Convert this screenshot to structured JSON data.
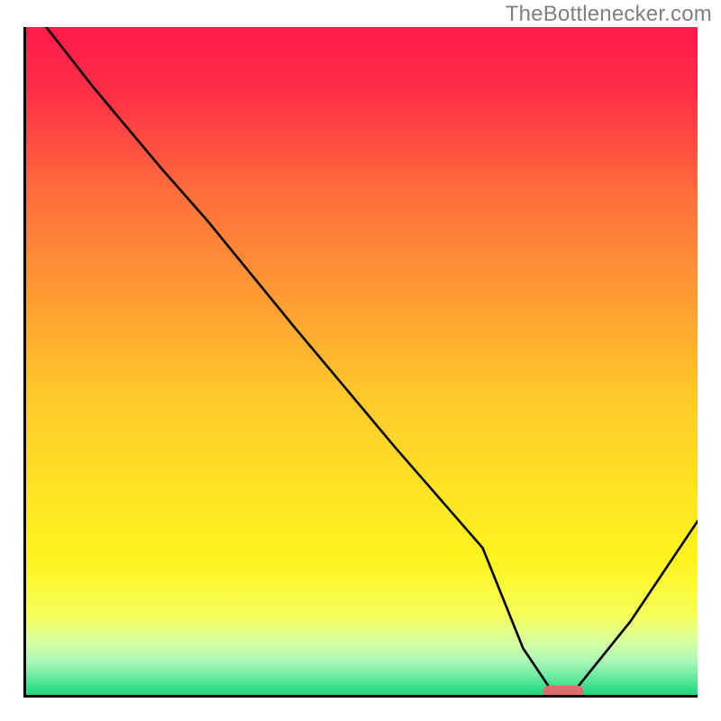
{
  "watermark": "TheBottlenecker.com",
  "chart_data": {
    "type": "line",
    "title": "",
    "xlabel": "",
    "ylabel": "",
    "xlim": [
      0,
      100
    ],
    "ylim": [
      0,
      100
    ],
    "x": [
      3,
      10,
      20,
      27,
      40,
      55,
      68,
      74,
      78,
      82,
      90,
      100
    ],
    "y": [
      100,
      91,
      79,
      71,
      55,
      37,
      22,
      7,
      1,
      1,
      11,
      26
    ],
    "curve_points": [
      {
        "x": 3,
        "y": 100
      },
      {
        "x": 10,
        "y": 91
      },
      {
        "x": 20,
        "y": 79
      },
      {
        "x": 27,
        "y": 71
      },
      {
        "x": 40,
        "y": 55
      },
      {
        "x": 55,
        "y": 37
      },
      {
        "x": 68,
        "y": 22
      },
      {
        "x": 74,
        "y": 7
      },
      {
        "x": 78,
        "y": 1
      },
      {
        "x": 82,
        "y": 1
      },
      {
        "x": 90,
        "y": 11
      },
      {
        "x": 100,
        "y": 26
      }
    ],
    "background_gradient": [
      {
        "offset": 0.0,
        "color": "#ff1a4b"
      },
      {
        "offset": 0.1,
        "color": "#ff2f47"
      },
      {
        "offset": 0.25,
        "color": "#ff6e3b"
      },
      {
        "offset": 0.4,
        "color": "#ff9a33"
      },
      {
        "offset": 0.55,
        "color": "#ffc82b"
      },
      {
        "offset": 0.7,
        "color": "#ffe423"
      },
      {
        "offset": 0.8,
        "color": "#fff31e"
      },
      {
        "offset": 0.88,
        "color": "#f6ff5a"
      },
      {
        "offset": 0.92,
        "color": "#d8ffa0"
      },
      {
        "offset": 0.95,
        "color": "#a9f6b8"
      },
      {
        "offset": 0.975,
        "color": "#63e89d"
      },
      {
        "offset": 1.0,
        "color": "#18d97f"
      }
    ],
    "marker": {
      "x_start": 77,
      "x_end": 83,
      "y": 0.5,
      "color": "#e26a6f",
      "height_frac": 0.018
    }
  }
}
